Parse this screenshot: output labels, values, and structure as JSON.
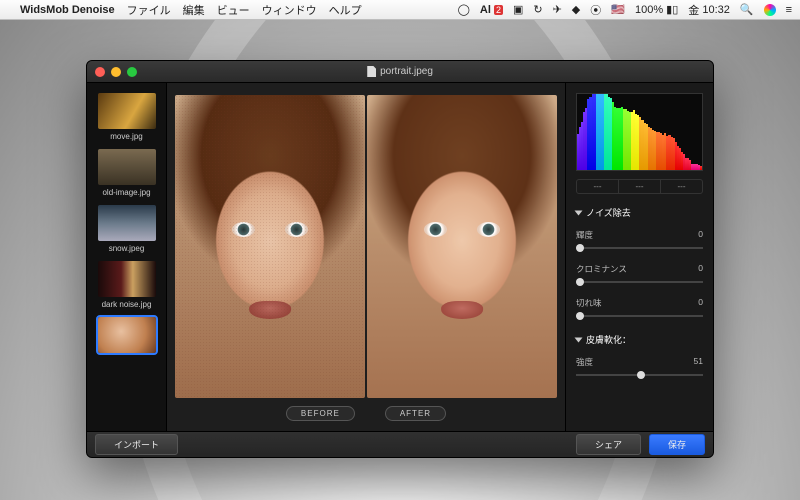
{
  "menubar": {
    "app_name": "WidsMob Denoise",
    "items": [
      "ファイル",
      "編集",
      "ビュー",
      "ウィンドウ",
      "ヘルプ"
    ],
    "right": {
      "adobe": "Al",
      "adobe_badge": "2",
      "battery": "100%",
      "flag": "🇺🇸",
      "day": "金",
      "time": "10:32"
    }
  },
  "window": {
    "filename": "portrait.jpeg",
    "before_label": "BEFORE",
    "after_label": "AFTER"
  },
  "sidebar": {
    "items": [
      {
        "label": "move.jpg"
      },
      {
        "label": "old-image.jpg"
      },
      {
        "label": "snow.jpeg"
      },
      {
        "label": "dark noise.jpg"
      },
      {
        "label": ""
      }
    ],
    "selected_index": 4
  },
  "panel": {
    "tabs": [
      "---",
      "---",
      "---"
    ],
    "noise_section": "ノイズ除去",
    "luminance": {
      "label": "輝度",
      "value": 0
    },
    "chrominance": {
      "label": "クロミナンス",
      "value": 0
    },
    "sharpness": {
      "label": "切れ味",
      "value": 0
    },
    "skin_section": "皮膚軟化：",
    "intensity": {
      "label": "強度",
      "value": 51
    }
  },
  "bottom": {
    "import": "インポート",
    "share": "シェア",
    "save": "保存"
  }
}
